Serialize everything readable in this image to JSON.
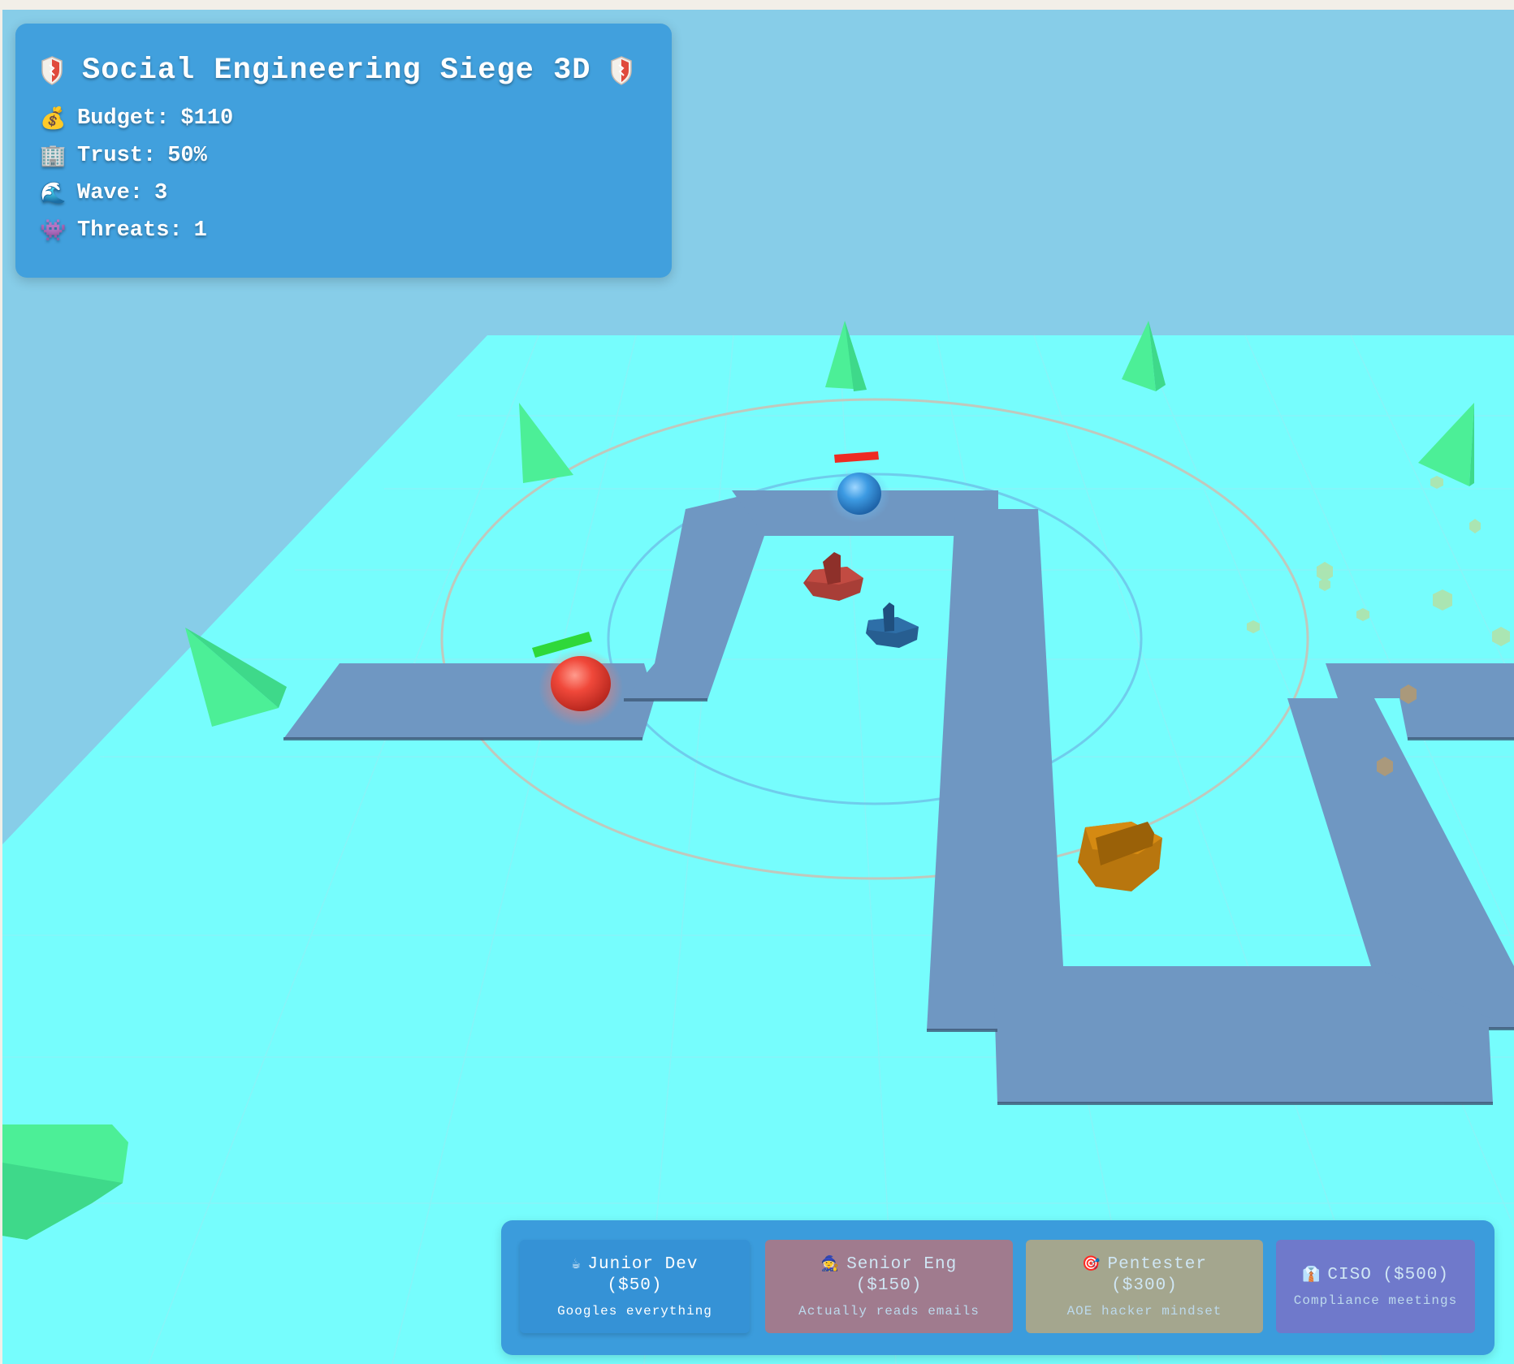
{
  "hud": {
    "title": "Social Engineering Siege 3D",
    "title_icon": "shield-icon",
    "stats": [
      {
        "icon": "💰",
        "icon_name": "money-bag-icon",
        "label": "Budget:",
        "value": "$110"
      },
      {
        "icon": "🏢",
        "icon_name": "office-building-icon",
        "label": "Trust:",
        "value": "50%"
      },
      {
        "icon": "🌊",
        "icon_name": "wave-icon",
        "label": "Wave:",
        "value": "3"
      },
      {
        "icon": "👾",
        "icon_name": "alien-monster-icon",
        "label": "Threats:",
        "value": "1"
      }
    ]
  },
  "shop": {
    "towers": [
      {
        "icon": "☕",
        "icon_name": "coffee-icon",
        "name": "Junior Dev",
        "cost": "($50)",
        "desc": "Googles everything",
        "selected": true
      },
      {
        "icon": "🧙",
        "icon_name": "wizard-icon",
        "name": "Senior Eng",
        "cost": "($150)",
        "desc": "Actually reads emails",
        "selected": false
      },
      {
        "icon": "🎯",
        "icon_name": "target-icon",
        "name": "Pentester",
        "cost": "($300)",
        "desc": "AOE hacker mindset",
        "selected": false
      },
      {
        "icon": "👔",
        "icon_name": "necktie-icon",
        "name": "CISO ($500)",
        "cost": "",
        "desc": "Compliance meetings",
        "selected": false
      }
    ]
  },
  "colors": {
    "sky": "#87cde8",
    "ground": "#76fdfd",
    "path": "#6f97c2",
    "tree": "#4cef97",
    "hud_bg": "#41a0dd",
    "enemy_red": "#e8453a",
    "enemy_blue": "#3a98e0",
    "tower_red": "#b2463e",
    "tower_blue": "#2e6fa8",
    "tower_orange": "#d58a12"
  }
}
